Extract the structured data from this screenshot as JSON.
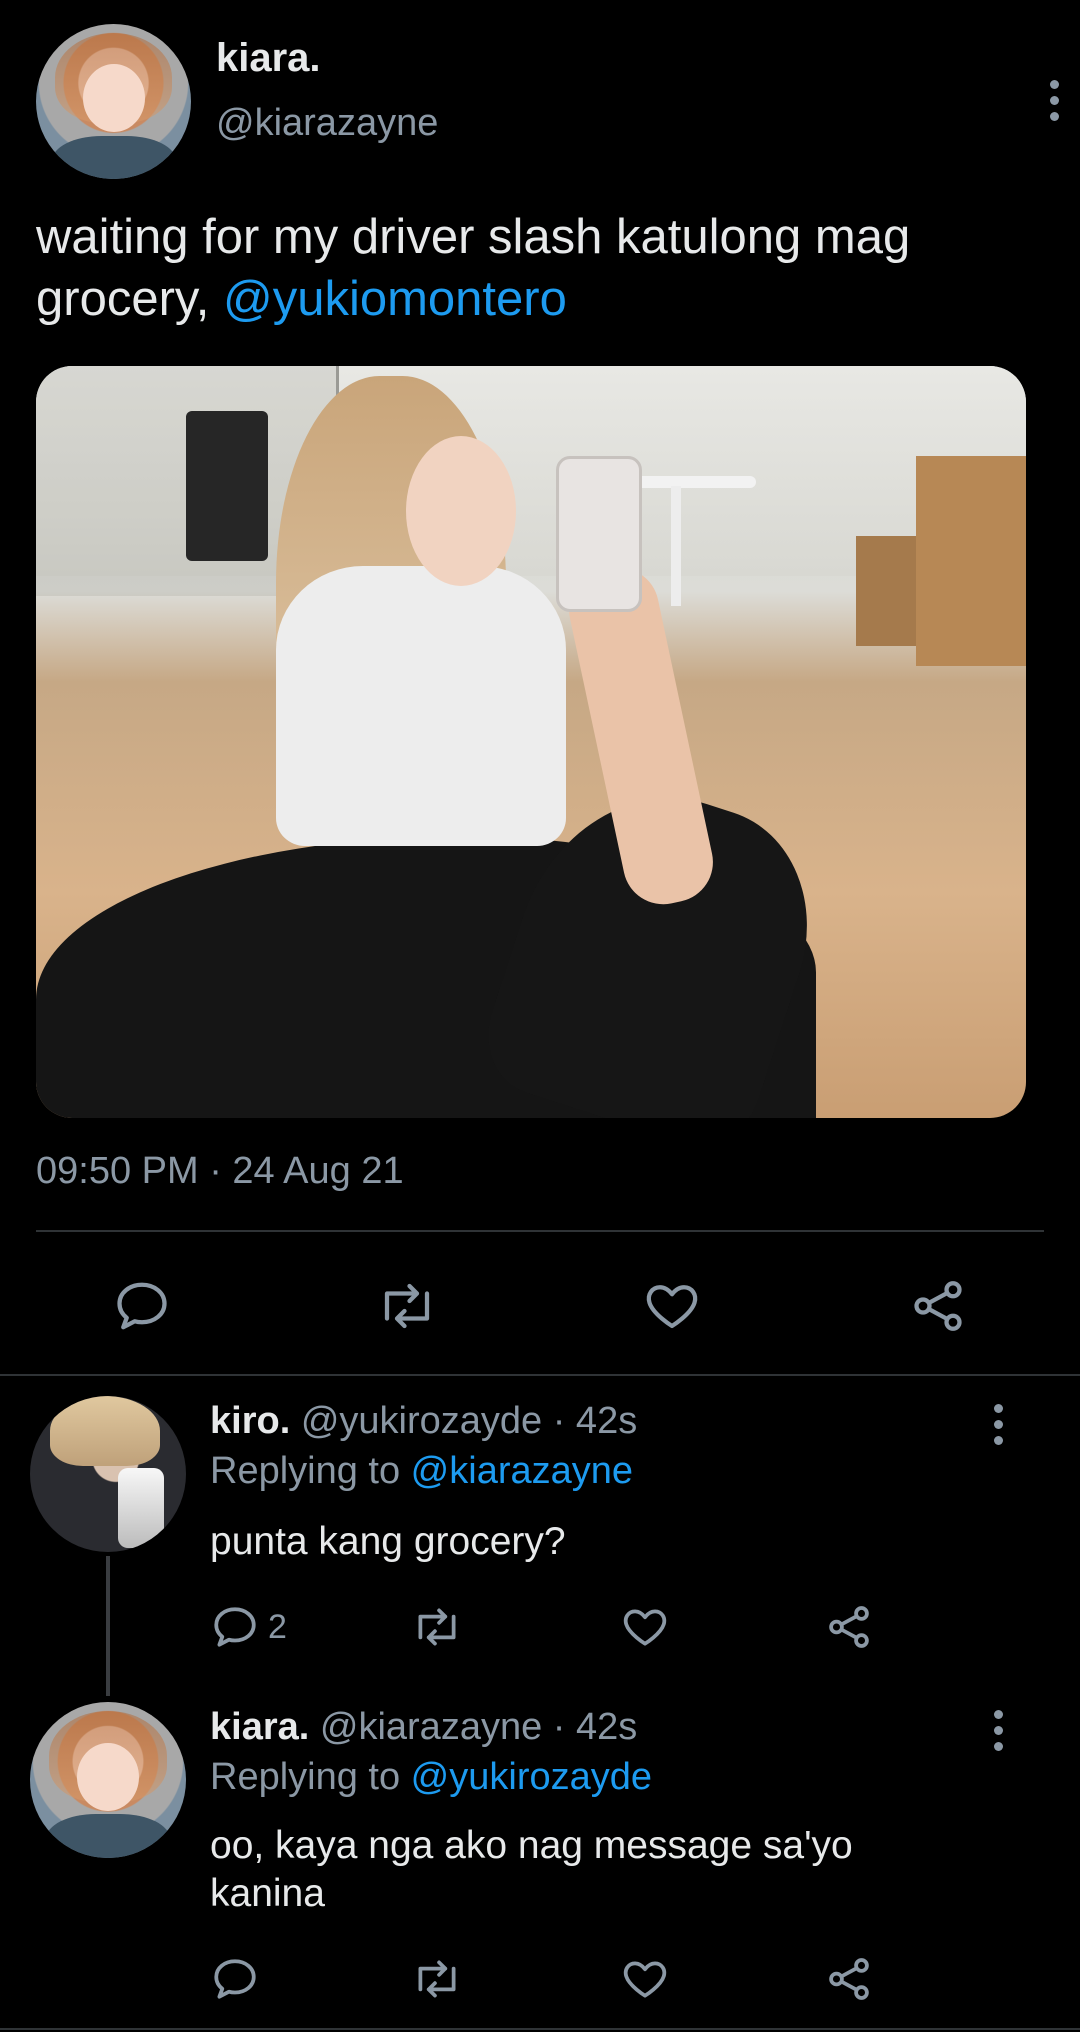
{
  "main_tweet": {
    "display_name": "kiara.",
    "handle": "@kiarazayne",
    "text": "waiting for my driver slash katulong mag grocery, ",
    "mention": "@yukiomontero",
    "timestamp": "09:50 PM · 24 Aug 21",
    "actions": {
      "reply_icon": "reply-icon",
      "retweet_icon": "retweet-icon",
      "like_icon": "heart-icon",
      "share_icon": "share-icon"
    }
  },
  "replies": [
    {
      "display_name": "kiro.",
      "handle": "@yukirozayde",
      "time": "· 42s",
      "replying_prefix": "Replying to ",
      "replying_to": "@kiarazayne",
      "text": "punta kang grocery?",
      "reply_count": "2"
    },
    {
      "display_name": "kiara.",
      "handle": "@kiarazayne",
      "time": "· 42s",
      "replying_prefix": "Replying to ",
      "replying_to": "@yukirozayde",
      "text": "oo, kaya nga ako nag message sa'yo kanina"
    }
  ],
  "colors": {
    "background": "#000000",
    "text": "#e7e9ea",
    "muted": "#8b98a5",
    "link": "#1d9bf0",
    "divider": "#2f3336"
  }
}
